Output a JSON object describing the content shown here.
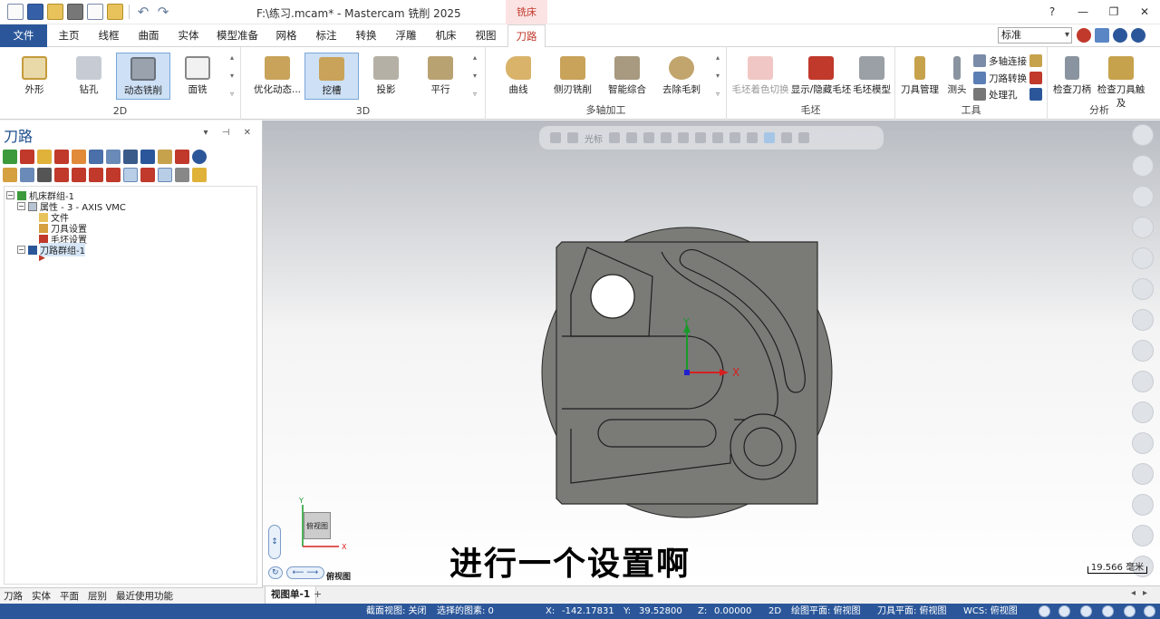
{
  "window": {
    "title": "F:\\练习.mcam* - Mastercam 铣削 2025",
    "context_tab": "铣床",
    "controls": [
      "?",
      "—",
      "❐",
      "✕"
    ]
  },
  "ribbon_tabs": [
    "文件",
    "主页",
    "线框",
    "曲面",
    "实体",
    "模型准备",
    "网格",
    "标注",
    "转换",
    "浮雕",
    "机床",
    "视图",
    "刀路"
  ],
  "active_tab": "刀路",
  "standard_select": "标准",
  "ribbon": {
    "group_2d": {
      "label": "2D",
      "buttons": [
        "外形",
        "钻孔",
        "动态铣削",
        "面铣"
      ],
      "selected": "动态铣削"
    },
    "group_3d": {
      "label": "3D",
      "buttons": [
        "优化动态...",
        "挖槽",
        "投影",
        "平行"
      ],
      "selected": "挖槽"
    },
    "group_multiaxis": {
      "label": "多轴加工",
      "buttons": [
        "曲线",
        "侧刃铣削",
        "智能综合",
        "去除毛刺"
      ]
    },
    "group_stock": {
      "label": "毛坯",
      "buttons": [
        "毛坯着色切换",
        "显示/隐藏毛坯",
        "毛坯模型"
      ]
    },
    "group_tools": {
      "label": "工具",
      "buttons": [
        "刀具管理",
        "测头"
      ],
      "small_buttons": [
        "多轴连接",
        "刀路转换",
        "处理孔"
      ]
    },
    "group_analysis": {
      "label": "分析",
      "buttons": [
        "检查刀柄",
        "检查刀具触及"
      ]
    }
  },
  "left_panel": {
    "title": "刀路",
    "tree": [
      {
        "label": "机床群组-1",
        "level": 0
      },
      {
        "label": "属性 - 3 - AXIS VMC",
        "level": 1
      },
      {
        "label": "文件",
        "level": 2
      },
      {
        "label": "刀具设置",
        "level": 2
      },
      {
        "label": "毛坯设置",
        "level": 2
      },
      {
        "label": "刀路群组-1",
        "level": 1
      },
      {
        "label": "",
        "level": 2
      }
    ],
    "bottom_tabs": [
      "刀路",
      "实体",
      "平面",
      "层别",
      "最近使用功能"
    ]
  },
  "viewport": {
    "toolbar_label": "光标",
    "caption": "进行一个设置啊",
    "scale_label": "19.566 毫米",
    "axis_x": "X",
    "axis_y": "Y",
    "gnomon_x": "X",
    "gnomon_y": "Y",
    "view_cube_label": "俯视图",
    "view_name": "俯视图",
    "colors": {
      "part_fill": "#7a7a77",
      "part_stroke": "#2a2a2a",
      "axis_x": "#d62020",
      "axis_y": "#1a9a2a",
      "origin": "#2020d0"
    }
  },
  "sheets": {
    "active": "视图单-1",
    "add": "+"
  },
  "status": {
    "section_view": "截面视图: 关闭",
    "selected": "选择的图素: 0",
    "x_label": "X:",
    "x_value": "-142.17831",
    "y_label": "Y:",
    "y_value": "39.52800",
    "z_label": "Z:",
    "z_value": "0.00000",
    "mode": "2D",
    "draw_plane": "绘图平面: 俯视图",
    "tool_plane": "刀具平面: 俯视图",
    "wcs": "WCS: 俯视图"
  }
}
